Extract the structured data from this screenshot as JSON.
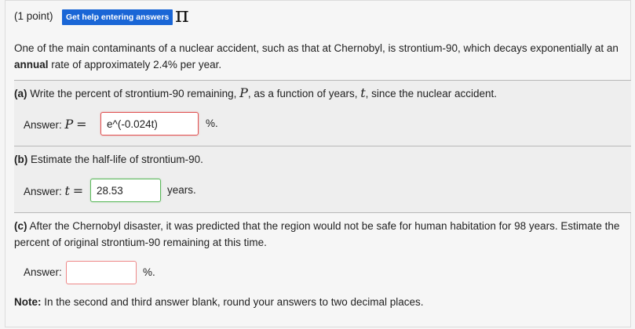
{
  "header": {
    "points": "(1 point)",
    "help_button": "Get help entering answers",
    "pi_glyph": "π"
  },
  "intro": {
    "text_before": "One of the main contaminants of a nuclear accident, such as that at Chernobyl, is strontium-90, which decays exponentially at an ",
    "bold": "annual",
    "text_after": " rate of approximately 2.4% per year."
  },
  "part_a": {
    "label": "(a)",
    "text_1": " Write the percent of strontium-90 remaining, ",
    "var_p": "P",
    "text_2": ", as a function of years, ",
    "var_t": "t",
    "text_3": ", since the nuclear accident.",
    "answer_label": "Answer: ",
    "answer_var": "P",
    "equals": "=",
    "value": "e^(-0.024t)",
    "unit": "%."
  },
  "part_b": {
    "label": "(b)",
    "text": " Estimate the half-life of strontium-90.",
    "answer_label": "Answer: ",
    "answer_var": "t",
    "equals": "=",
    "value": "28.53",
    "unit": "years."
  },
  "part_c": {
    "label": "(c)",
    "text": " After the Chernobyl disaster, it was predicted that the region would not be safe for human habitation for 98 years. Estimate the percent of original strontium-90 remaining at this time.",
    "answer_label": "Answer:",
    "value": "",
    "unit": "%."
  },
  "note": {
    "bold": "Note:",
    "text": " In the second and third answer blank, round your answers to two decimal places."
  }
}
